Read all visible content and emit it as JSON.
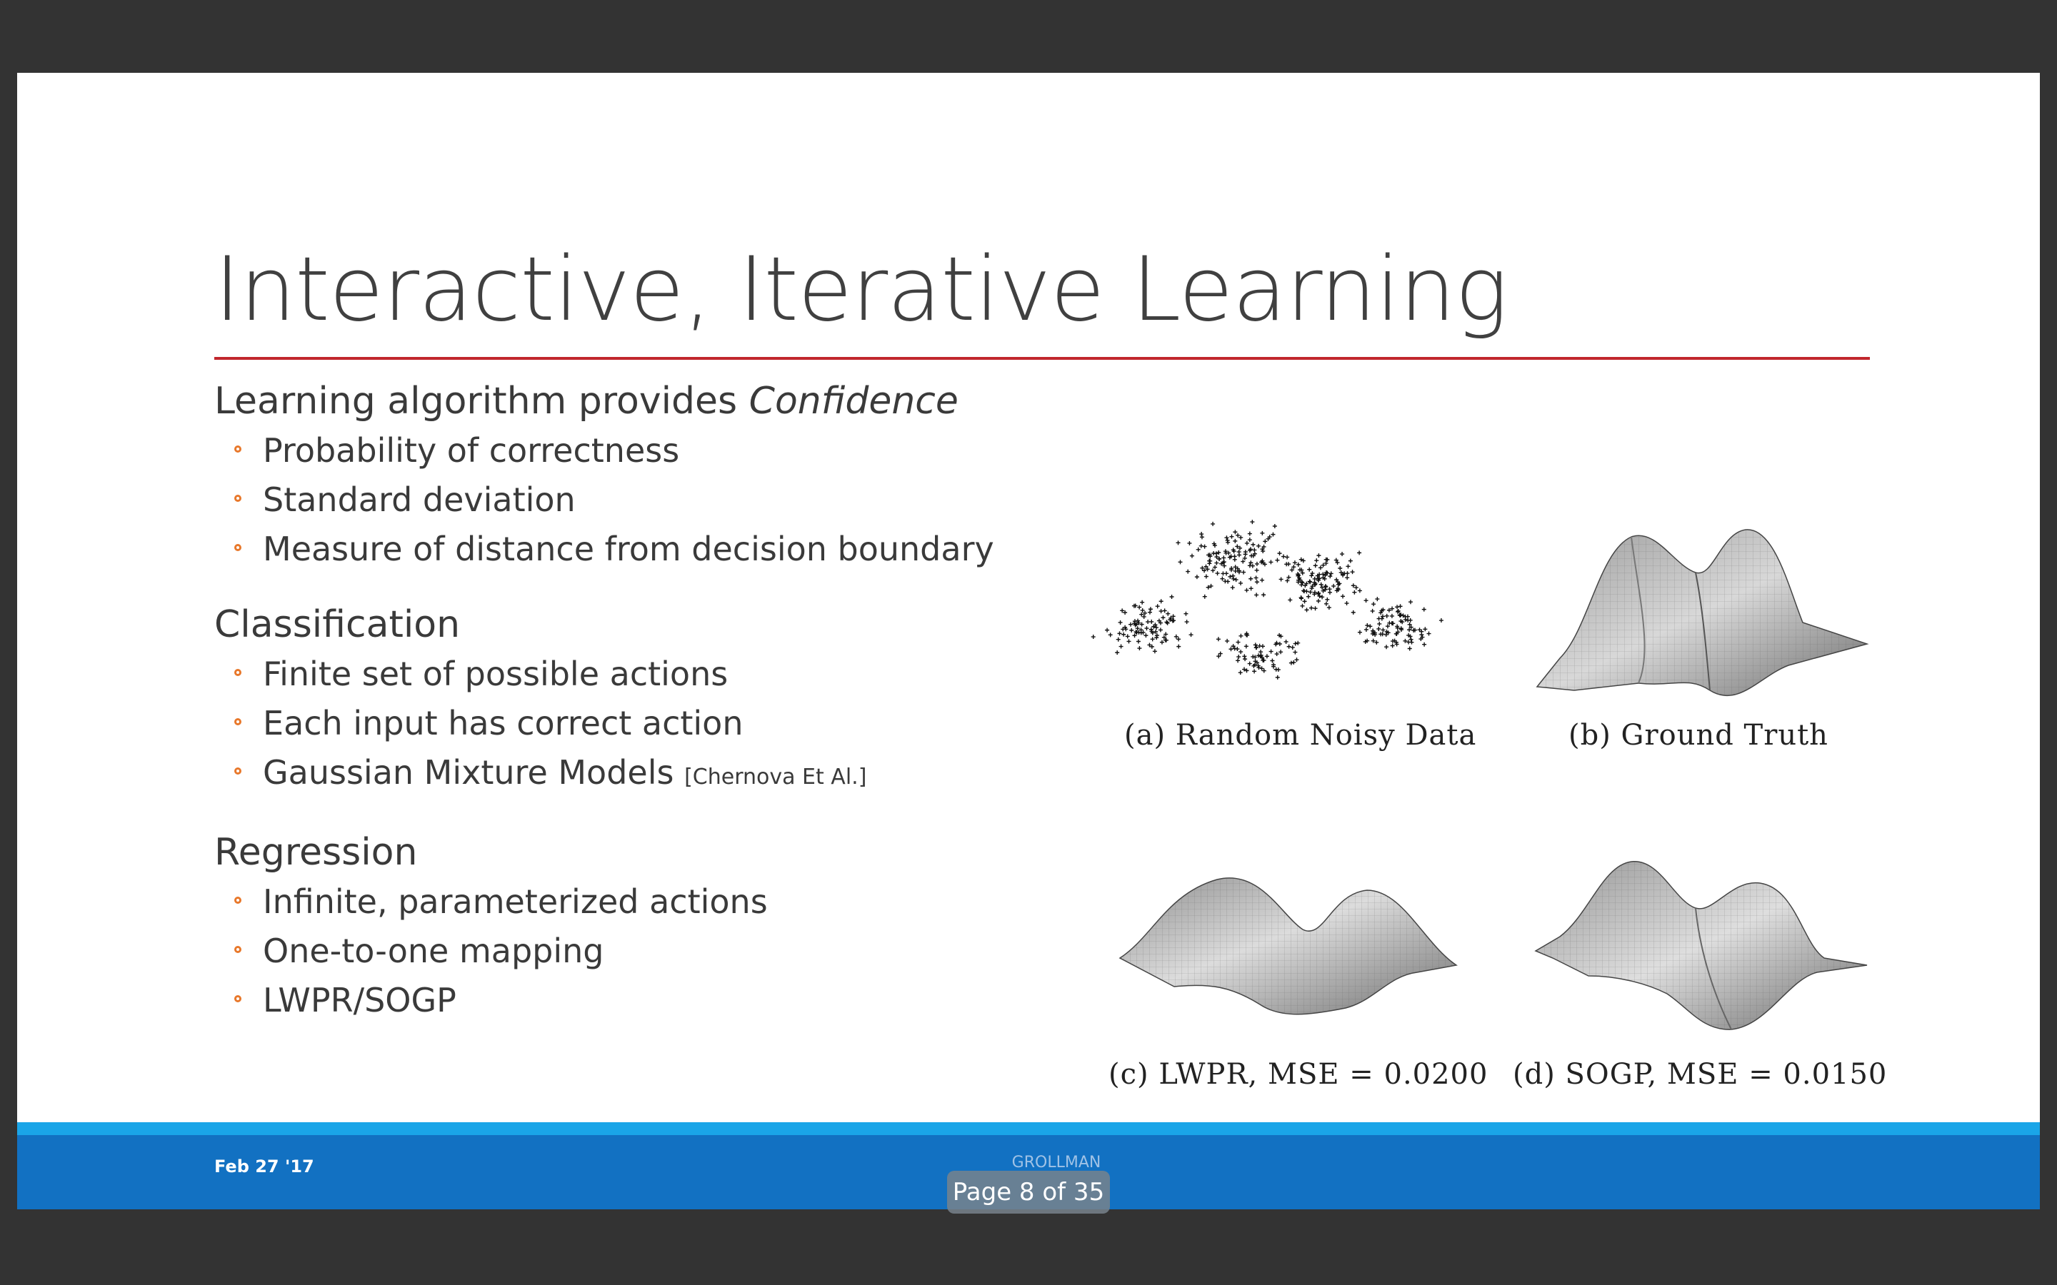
{
  "slide": {
    "title": "Interactive, Iterative Learning",
    "sections": [
      {
        "heading_plain": "Learning algorithm provides ",
        "heading_emph": "Confidence",
        "bullets": [
          "Probability of correctness",
          "Standard deviation",
          "Measure of distance from decision boundary"
        ]
      },
      {
        "heading": "Classification",
        "bullets": [
          "Finite set of possible actions",
          "Each input has correct action"
        ],
        "citation_bullet": {
          "text": "Gaussian Mixture Models ",
          "citation": "[Chernova Et Al.]"
        }
      },
      {
        "heading": "Regression",
        "bullets": [
          "Infinite, parameterized actions",
          "One-to-one mapping",
          "LWPR/SOGP"
        ]
      }
    ],
    "figure": {
      "captions": {
        "a": "(a) Random Noisy Data",
        "b": "(b) Ground Truth",
        "c": "(c) LWPR, MSE = 0.0200",
        "d": "(d) SOGP, MSE = 0.0150"
      }
    },
    "footer": {
      "date": "Feb 27 '17",
      "author": "GROLLMAN"
    }
  },
  "viewer": {
    "page_indicator": "Page 8 of 35"
  },
  "colors": {
    "background": "#333333",
    "title_rule": "#c1272d",
    "bullet_accent": "#e8782b",
    "footer_stripe": "#1aa5e8",
    "footer": "#1271c2"
  }
}
